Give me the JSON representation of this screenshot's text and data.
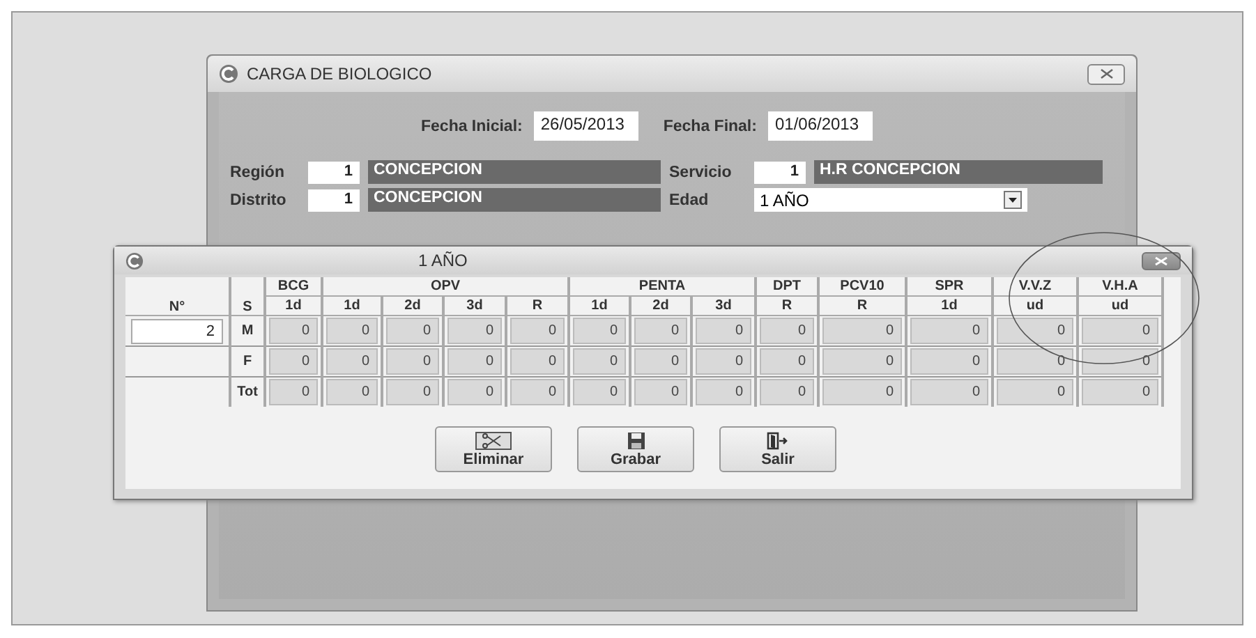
{
  "window": {
    "title": "CARGA DE BIOLOGICO"
  },
  "fecha_inicial": {
    "label": "Fecha Inicial:",
    "value": "26/05/2013"
  },
  "fecha_final": {
    "label": "Fecha Final:",
    "value": "01/06/2013"
  },
  "region": {
    "label": "Región",
    "code": "1",
    "name": "CONCEPCION"
  },
  "servicio": {
    "label": "Servicio",
    "code": "1",
    "name": "H.R CONCEPCION"
  },
  "distrito": {
    "label": "Distrito",
    "code": "1",
    "name": "CONCEPCION"
  },
  "edad": {
    "label": "Edad",
    "value": "1 AÑO"
  },
  "dialog": {
    "title": "1 AÑO",
    "number_field": {
      "label": "N°",
      "value": "2"
    },
    "sex_header": "S",
    "groups": [
      {
        "label": "BCG",
        "columns": [
          "1d"
        ]
      },
      {
        "label": "OPV",
        "columns": [
          "1d",
          "2d",
          "3d",
          "R"
        ]
      },
      {
        "label": "PENTA",
        "columns": [
          "1d",
          "2d",
          "3d"
        ]
      },
      {
        "label": "DPT",
        "columns": [
          "R"
        ]
      },
      {
        "label": "PCV10",
        "columns": [
          "R"
        ]
      },
      {
        "label": "SPR",
        "columns": [
          "1d"
        ]
      },
      {
        "label": "V.V.Z",
        "columns": [
          "ud"
        ]
      },
      {
        "label": "V.H.A",
        "columns": [
          "ud"
        ]
      }
    ],
    "rows": [
      {
        "sex": "M",
        "values": [
          "0",
          "0",
          "0",
          "0",
          "0",
          "0",
          "0",
          "0",
          "0",
          "0",
          "0",
          "0",
          "0"
        ]
      },
      {
        "sex": "F",
        "values": [
          "0",
          "0",
          "0",
          "0",
          "0",
          "0",
          "0",
          "0",
          "0",
          "0",
          "0",
          "0",
          "0"
        ]
      },
      {
        "sex": "Tot",
        "values": [
          "0",
          "0",
          "0",
          "0",
          "0",
          "0",
          "0",
          "0",
          "0",
          "0",
          "0",
          "0",
          "0"
        ]
      }
    ],
    "buttons": [
      {
        "label": "Eliminar",
        "kind": "delete"
      },
      {
        "label": "Grabar",
        "kind": "save"
      },
      {
        "label": "Salir",
        "kind": "exit"
      }
    ]
  }
}
